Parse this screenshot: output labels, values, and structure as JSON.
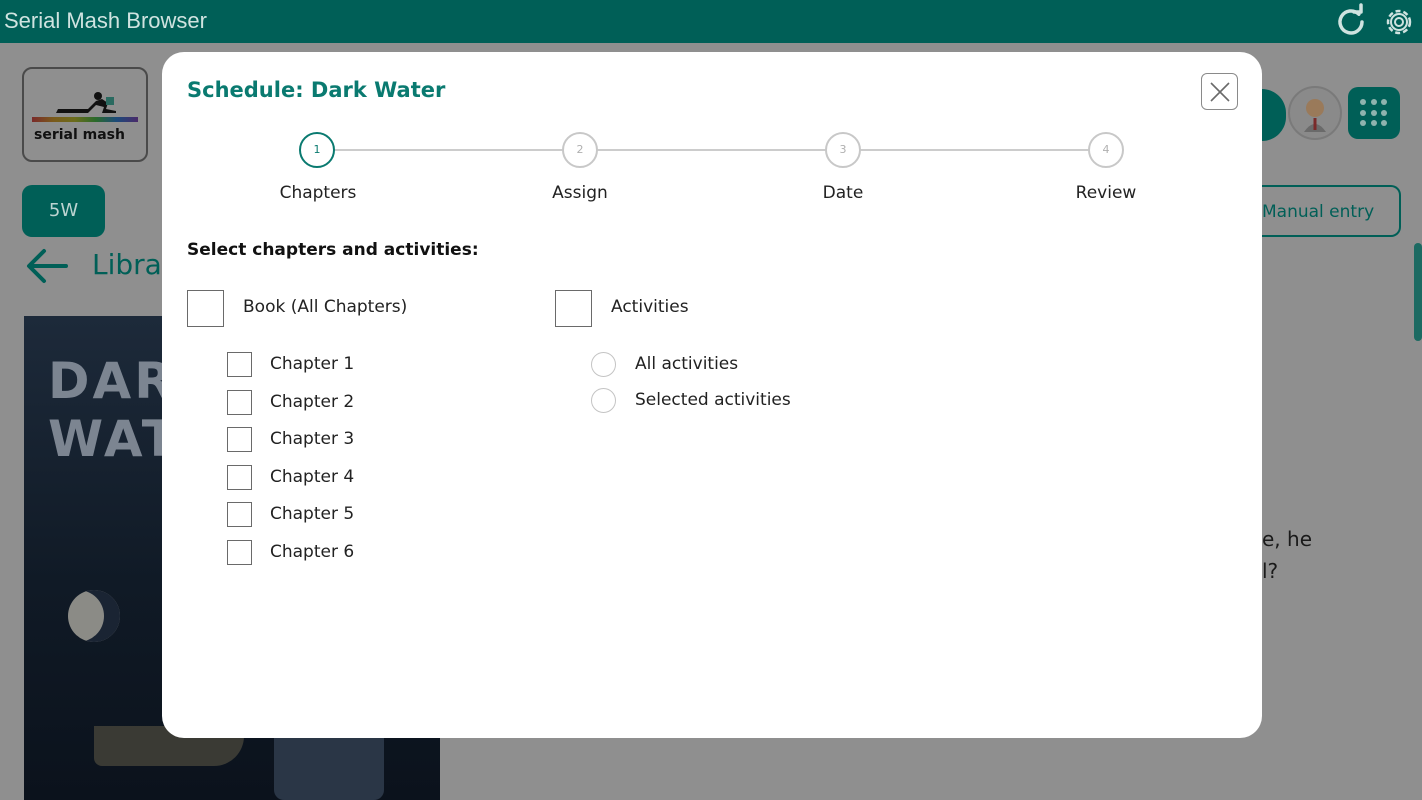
{
  "app": {
    "title": "Serial Mash Browser",
    "header_icons": [
      "refresh-icon",
      "gear-icon"
    ]
  },
  "background": {
    "logo_text": "serial mash",
    "class_button": "5W",
    "library_text": "Library",
    "book_cover_title": "DARK WATER",
    "manual_entry": "Manual entry",
    "snippet_line_1": "e, he",
    "snippet_line_2": "l?"
  },
  "modal": {
    "title": "Schedule: Dark Water",
    "steps": [
      {
        "number": "1",
        "label": "Chapters",
        "active": true
      },
      {
        "number": "2",
        "label": "Assign",
        "active": false
      },
      {
        "number": "3",
        "label": "Date",
        "active": false
      },
      {
        "number": "4",
        "label": "Review",
        "active": false
      }
    ],
    "heading": "Select chapters and activities:",
    "book_option": "Book (All Chapters)",
    "chapters": [
      "Chapter 1",
      "Chapter 2",
      "Chapter 3",
      "Chapter 4",
      "Chapter 5",
      "Chapter 6"
    ],
    "activities_option": "Activities",
    "activity_choices": [
      "All activities",
      "Selected activities"
    ]
  },
  "colors": {
    "brand_teal": "#005f57",
    "accent_teal": "#0a7a70"
  }
}
